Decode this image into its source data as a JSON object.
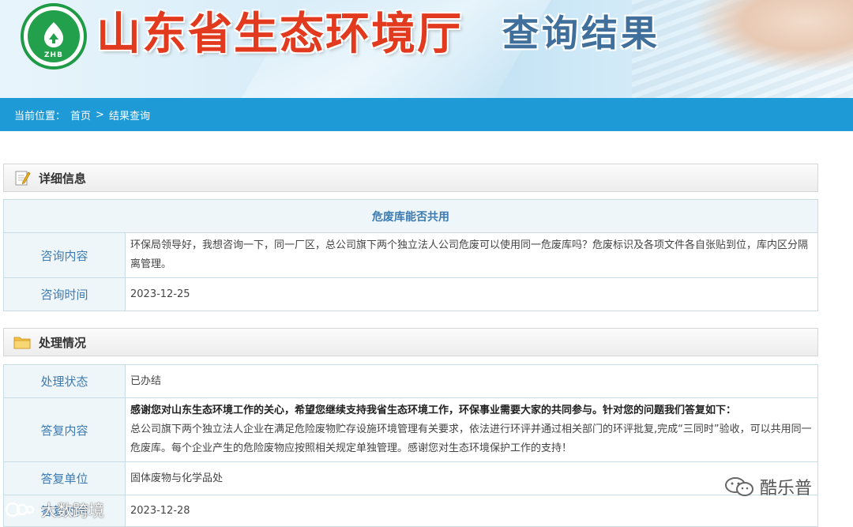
{
  "header": {
    "logo_text": "ZHB",
    "site_title": "山东省生态环境厅",
    "page_heading": "查询结果"
  },
  "breadcrumb": {
    "prefix": "当前位置：",
    "home": "首页",
    "separator": ">",
    "current": "结果查询"
  },
  "detail": {
    "section_label": "详细信息",
    "title": "危废库能否共用",
    "rows": [
      {
        "label": "咨询内容",
        "value": "环保局领导好，我想咨询一下，同一厂区，总公司旗下两个独立法人公司危废可以使用同一危废库吗？危废标识及各项文件各自张贴到位，库内区分隔离管理。"
      },
      {
        "label": "咨询时间",
        "value": "2023-12-25"
      }
    ]
  },
  "handling": {
    "section_label": "处理情况",
    "status_label": "处理状态",
    "status_value": "已办结",
    "reply_label": "答复内容",
    "reply_intro": "感谢您对山东生态环境工作的关心，希望您继续支持我省生态环境工作，环保事业需要大家的共同参与。针对您的问题我们答复如下：",
    "reply_body": "总公司旗下两个独立法人企业在满足危险废物贮存设施环境管理有关要求，依法进行环评并通过相关部门的环评批复,完成“三同时”验收，可以共用同一危废库。每个企业产生的危险废物应按照相关规定单独管理。感谢您对生态环境保护工作的支持！",
    "unit_label": "答复单位",
    "unit_value": "固体废物与化学品处",
    "time_label": "答复时间",
    "time_value": "2023-12-28"
  },
  "watermarks": {
    "right": "酷乐普",
    "left": "大数跨境"
  },
  "colors": {
    "breadcrumb_bg": "#1e9bd7",
    "title_red": "#e23a1f",
    "label_blue": "#3d7bb1",
    "logo_green": "#1f9a45"
  }
}
